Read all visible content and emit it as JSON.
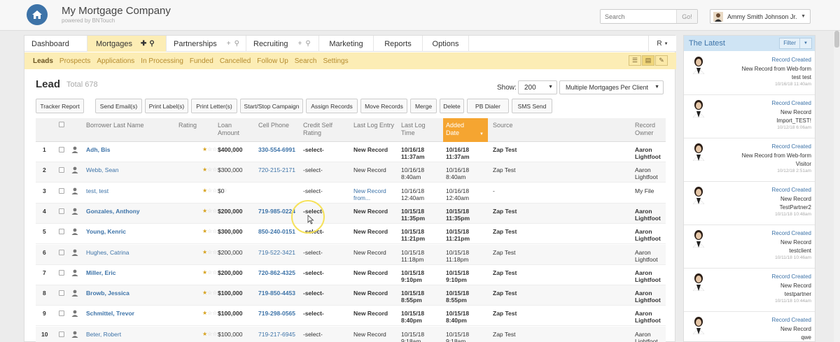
{
  "header": {
    "title": "My Mortgage Company",
    "subtitle": "powered by BNTouch",
    "search_placeholder": "Search",
    "search_go": "Go!",
    "user_name": "Ammy Smith Johnson Jr."
  },
  "tabs": [
    {
      "label": "Dashboard"
    },
    {
      "label": "Mortgages"
    },
    {
      "label": "Partnerships"
    },
    {
      "label": "Recruiting"
    },
    {
      "label": "Marketing"
    },
    {
      "label": "Reports"
    },
    {
      "label": "Options"
    }
  ],
  "tab_right_label": "R",
  "subnav": [
    "Leads",
    "Prospects",
    "Applications",
    "In Processing",
    "Funded",
    "Cancelled",
    "Follow Up",
    "Search",
    "Settings"
  ],
  "lead": {
    "title": "Lead",
    "total": "Total 678",
    "show_label": "Show:",
    "show_value": "200",
    "filter_value": "Multiple Mortgages Per Client"
  },
  "actions": [
    "Tracker Report",
    "Send Email(s)",
    "Print Label(s)",
    "Print Letter(s)",
    "Start/Stop Campaign",
    "Assign Records",
    "Move Records",
    "Merge",
    "Delete",
    "PB Dialer",
    "SMS Send"
  ],
  "columns": {
    "borrower": "Borrower Last Name",
    "rating": "Rating",
    "loan": "Loan Amount",
    "cell": "Cell Phone",
    "credit": "Credit Self Rating",
    "lastlog": "Last Log Entry",
    "lasttime": "Last Log Time",
    "added": "Added Date",
    "source": "Source",
    "owner": "Record Owner"
  },
  "rows": [
    {
      "num": "1",
      "name": "Adh, Bis",
      "stars": 1,
      "loan": "$400,000",
      "phone": "330-554-6991",
      "credit": "-select-",
      "log": "New Record",
      "logtime": "10/16/18 11:37am",
      "added": "10/16/18 11:37am",
      "source": "Zap Test",
      "owner": "Aaron Lightfoot",
      "bold": true
    },
    {
      "num": "2",
      "name": "Webb, Sean",
      "stars": 1,
      "loan": "$300,000",
      "phone": "720-215-2171",
      "credit": "-select-",
      "log": "New Record",
      "logtime": "10/16/18 8:40am",
      "added": "10/16/18 8:40am",
      "source": "Zap Test",
      "owner": "Aaron Lightfoot",
      "bold": false
    },
    {
      "num": "3",
      "name": "test, test",
      "stars": 1,
      "loan": "$0",
      "phone": "",
      "credit": "-select-",
      "log": "New Record from...",
      "logtime": "10/16/18 12:40am",
      "added": "10/16/18 12:40am",
      "source": "-",
      "owner": "My File",
      "bold": false
    },
    {
      "num": "4",
      "name": "Gonzales, Anthony",
      "stars": 1,
      "loan": "$200,000",
      "phone": "719-985-0224",
      "credit": "-select-",
      "log": "New Record",
      "logtime": "10/15/18 11:35pm",
      "added": "10/15/18 11:35pm",
      "source": "Zap Test",
      "owner": "Aaron Lightfoot",
      "bold": true
    },
    {
      "num": "5",
      "name": "Young, Kenric",
      "stars": 1,
      "loan": "$300,000",
      "phone": "850-240-0151",
      "credit": "-select-",
      "log": "New Record",
      "logtime": "10/15/18 11:21pm",
      "added": "10/15/18 11:21pm",
      "source": "Zap Test",
      "owner": "Aaron Lightfoot",
      "bold": true
    },
    {
      "num": "6",
      "name": "Hughes, Catrina",
      "stars": 1,
      "loan": "$200,000",
      "phone": "719-522-3421",
      "credit": "-select-",
      "log": "New Record",
      "logtime": "10/15/18 11:18pm",
      "added": "10/15/18 11:18pm",
      "source": "Zap Test",
      "owner": "Aaron Lightfoot",
      "bold": false
    },
    {
      "num": "7",
      "name": "Miller, Eric",
      "stars": 1,
      "loan": "$200,000",
      "phone": "720-862-4325",
      "credit": "-select-",
      "log": "New Record",
      "logtime": "10/15/18 9:10pm",
      "added": "10/15/18 9:10pm",
      "source": "Zap Test",
      "owner": "Aaron Lightfoot",
      "bold": true
    },
    {
      "num": "8",
      "name": "Browb, Jessica",
      "stars": 1,
      "loan": "$100,000",
      "phone": "719-850-4453",
      "credit": "-select-",
      "log": "New Record",
      "logtime": "10/15/18 8:55pm",
      "added": "10/15/18 8:55pm",
      "source": "Zap Test",
      "owner": "Aaron Lightfoot",
      "bold": true
    },
    {
      "num": "9",
      "name": "Schmittel, Trevor",
      "stars": 1,
      "loan": "$100,000",
      "phone": "719-298-0565",
      "credit": "-select-",
      "log": "New Record",
      "logtime": "10/15/18 8:40pm",
      "added": "10/15/18 8:40pm",
      "source": "Zap Test",
      "owner": "Aaron Lightfoot",
      "bold": true
    },
    {
      "num": "10",
      "name": "Beter, Robert",
      "stars": 1,
      "loan": "$100,000",
      "phone": "719-217-6945",
      "credit": "-select-",
      "log": "New Record",
      "logtime": "10/15/18 9:18am",
      "added": "10/15/18 9:18am",
      "source": "Zap Test",
      "owner": "Aaron Lightfoot",
      "bold": false
    }
  ],
  "latest": {
    "title": "The Latest",
    "filter": "Filter",
    "items": [
      {
        "title": "Record Created",
        "l1": "New Record from Web-form",
        "l2": "test test",
        "ts": "10/16/18 11:40am"
      },
      {
        "title": "Record Created",
        "l1": "New Record",
        "l2": "Import_TEST!",
        "ts": "10/12/18 6:06am"
      },
      {
        "title": "Record Created",
        "l1": "New Record from Web-form",
        "l2": "Visitor",
        "ts": "10/12/18 2:51am"
      },
      {
        "title": "Record Created",
        "l1": "New Record",
        "l2": "TestPartner2",
        "ts": "10/11/18 10:48am"
      },
      {
        "title": "Record Created",
        "l1": "New Record",
        "l2": "testclient",
        "ts": "10/11/18 10:46am"
      },
      {
        "title": "Record Created",
        "l1": "New Record",
        "l2": "testpartner",
        "ts": "10/11/18 10:44am"
      },
      {
        "title": "Record Created",
        "l1": "New Record",
        "l2": "qwe",
        "ts": ""
      }
    ]
  },
  "colors": {
    "accent": "#f5a531",
    "nav_bg": "#fcedb5",
    "link": "#3d73a8",
    "star": "#d6a21e"
  }
}
